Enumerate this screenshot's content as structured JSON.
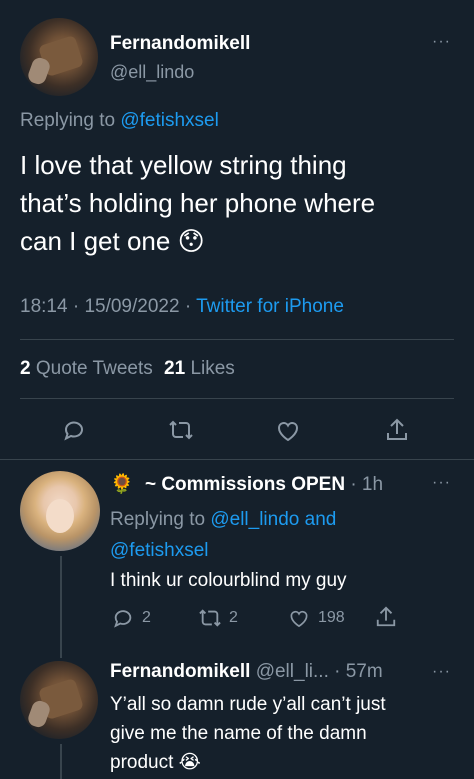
{
  "main_tweet": {
    "display_name": "Fernandomikell",
    "handle": "@ell_lindo",
    "replying_prefix": "Replying to",
    "replying_to": "@fetishxsel",
    "text_lines": [
      "I love that yellow string thing",
      "that’s holding her phone where",
      "can I get one"
    ],
    "emoji": "😯",
    "time": "18:14",
    "date": "15/09/2022",
    "source": "Twitter for iPhone",
    "quote_count": "2",
    "quote_label": "Quote Tweets",
    "like_count": "21",
    "like_label": "Likes"
  },
  "reply1": {
    "emoji": "🌻",
    "display_name": "~ Commissions OPEN",
    "age": "· 1h",
    "replying_prefix": "Replying to",
    "replying_line1": "@ell_lindo and",
    "replying_line2": "@fetishxsel",
    "text": "I think ur colourblind my guy",
    "reply_count": "2",
    "retweet_count": "2",
    "like_count": "198"
  },
  "reply2": {
    "display_name": "Fernandomikell",
    "handle_age": "@ell_li... · 57m",
    "text_lines": [
      "Y’all so damn rude y’all can’t just",
      "give me the name of the damn",
      "product"
    ],
    "emoji": "😭"
  },
  "icons": {
    "more": "more-icon",
    "reply": "reply-icon",
    "retweet": "retweet-icon",
    "like": "heart-icon",
    "share": "share-icon"
  }
}
